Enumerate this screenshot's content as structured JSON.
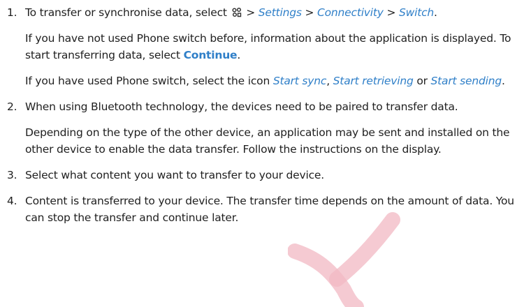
{
  "steps": [
    {
      "num": "1.",
      "para1": {
        "lead": "To transfer or synchronise data, select",
        "menu_icon": "menu-key-icon",
        "sep1": " > ",
        "item1": "Settings",
        "sep2": " > ",
        "item2": "Connectivity",
        "sep3": " > ",
        "item3": "Switch",
        "end": "."
      },
      "para2": {
        "text": "If you have not used Phone switch before, information about the application is displayed. To start transferring data, select ",
        "action": "Continue",
        "end": "."
      },
      "para3": {
        "text": "If you have used Phone switch, select the icon ",
        "opt1": "Start sync",
        "sep1": ", ",
        "opt2": "Start retrieving",
        "sep2": " or ",
        "opt3": "Start sending",
        "end": "."
      }
    },
    {
      "num": "2.",
      "para1": "When using Bluetooth technology, the devices need to be paired to transfer data.",
      "para2": "Depending on the type of the other device, an application may be sent and installed on the other device to enable the data transfer. Follow the instructions on the display."
    },
    {
      "num": "3.",
      "para1": "Select what content you want to transfer to your device."
    },
    {
      "num": "4.",
      "para1": "Content is transferred to your device. The transfer time depends on the amount of data. You can stop the transfer and continue later."
    }
  ],
  "colors": {
    "link": "#2f7fc8",
    "text": "#1f1f1f",
    "watermark": "#f2b8c3"
  }
}
